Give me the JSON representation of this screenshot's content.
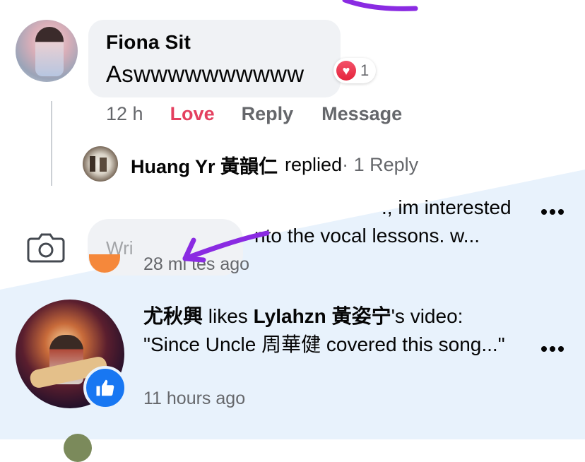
{
  "comment": {
    "author": "Fiona Sit",
    "text": "Aswwwwwwwwww",
    "reaction_count": "1",
    "time": "12 h",
    "actions": {
      "love": "Love",
      "reply": "Reply",
      "message": "Message"
    }
  },
  "reply_summary": {
    "name": "Huang Yr 黃韻仁",
    "verb": "replied",
    "count": " · 1 Reply"
  },
  "composer": {
    "placeholder": "Wri"
  },
  "notification_partial": {
    "line1": "., im interested",
    "line2": "nto the vocal lessons. w...",
    "time": "28 mi    tes ago"
  },
  "notification": {
    "actor": "尤秋興",
    "verb": " likes ",
    "target": "Lylahzn 黃姿宁",
    "suffix": "'s video: \"Since Uncle 周華健 covered this song...\"",
    "time": "11 hours ago"
  },
  "colors": {
    "love_red": "#e4405f",
    "facebook_blue": "#1877f2",
    "notification_bg": "#e8f2fc",
    "annotation_purple": "#8a2be2"
  },
  "icons": {
    "reaction": "heart-icon",
    "camera": "camera-icon",
    "more": "more-options-icon",
    "like_badge": "thumbs-up-icon"
  }
}
